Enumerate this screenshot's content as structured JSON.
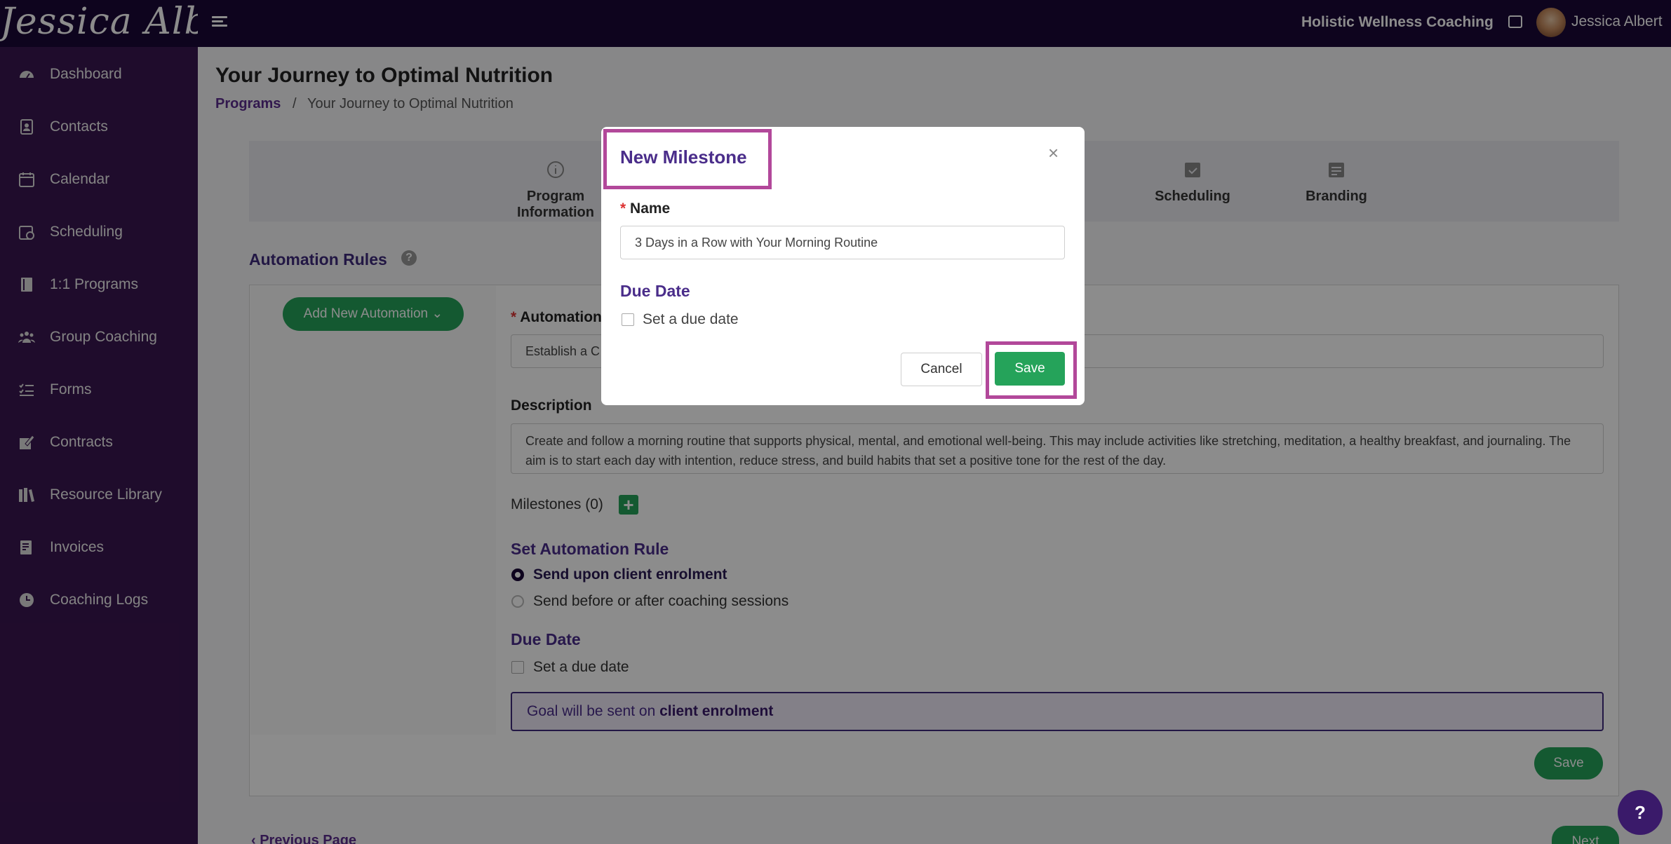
{
  "topbar": {
    "logo_text": "Jessica Albert",
    "business_name": "Holistic Wellness Coaching",
    "user_name": "Jessica Albert"
  },
  "sidebar": {
    "items": [
      {
        "label": "Dashboard",
        "icon": "dashboard-icon"
      },
      {
        "label": "Contacts",
        "icon": "contacts-icon"
      },
      {
        "label": "Calendar",
        "icon": "calendar-icon"
      },
      {
        "label": "Scheduling",
        "icon": "scheduling-icon"
      },
      {
        "label": "1:1 Programs",
        "icon": "book-icon"
      },
      {
        "label": "Group Coaching",
        "icon": "group-icon"
      },
      {
        "label": "Forms",
        "icon": "forms-icon"
      },
      {
        "label": "Contracts",
        "icon": "contract-icon"
      },
      {
        "label": "Resource Library",
        "icon": "library-icon"
      },
      {
        "label": "Invoices",
        "icon": "invoice-icon"
      },
      {
        "label": "Coaching Logs",
        "icon": "clock-icon"
      }
    ]
  },
  "page": {
    "title": "Your Journey to Optimal Nutrition",
    "breadcrumb_link": "Programs",
    "breadcrumb_sep": "/",
    "breadcrumb_current": "Your Journey to Optimal Nutrition"
  },
  "steps": {
    "program_info_line1": "Program",
    "program_info_line2": "Information",
    "scheduling": "Scheduling",
    "branding": "Branding"
  },
  "automation": {
    "section_title": "Automation Rules",
    "help_glyph": "?",
    "add_button": "Add New Automation",
    "name_label": "Automation",
    "name_value": "Establish a C",
    "description_label": "Description",
    "description_value": "Create and follow a morning routine that supports physical, mental, and emotional well-being. This may include activities like stretching, meditation, a healthy breakfast, and journaling. The aim is to start each day with intention, reduce stress, and build habits that set a positive tone for the rest of the day.",
    "milestones_label": "Milestones (0)",
    "milestones_add": "+",
    "rule_title": "Set Automation Rule",
    "rule_option1": "Send upon client enrolment",
    "rule_option2": "Send before or after coaching sessions",
    "due_title": "Due Date",
    "due_checkbox": "Set a due date",
    "info_prefix": "Goal will be sent on",
    "info_bold": "client enrolment",
    "save_label": "Save",
    "prev_page": "‹ Previous Page",
    "next_label": "Next"
  },
  "modal": {
    "title": "New Milestone",
    "close_glyph": "×",
    "name_required": "*",
    "name_label": "Name",
    "name_value": "3 Days in a Row with Your Morning Routine",
    "due_title": "Due Date",
    "due_checkbox": "Set a due date",
    "cancel": "Cancel",
    "save": "Save"
  },
  "help_fab": "?",
  "colors": {
    "topbar": "#1b0838",
    "sidebar": "#3a1650",
    "primary_green": "#25a35a",
    "accent_purple": "#4a2d8a",
    "highlight_magenta": "#b2489a"
  }
}
